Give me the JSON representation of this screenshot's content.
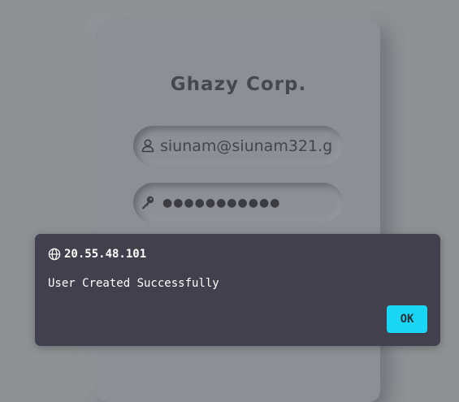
{
  "card": {
    "title": "Ghazy Corp."
  },
  "form": {
    "email_value": "siunam@siunam321.g",
    "password_value": "●●●●●●●●●●●",
    "user_icon": "user-icon",
    "password_icon": "key-icon"
  },
  "dialog": {
    "origin": "20.55.48.101",
    "origin_icon": "globe-icon",
    "message": "User Created Successfully",
    "ok_label": "OK"
  },
  "colors": {
    "page_background": "#8f9094",
    "dialog_background": "#43404d",
    "ok_button": "#18d6f4",
    "title_text": "#48484c"
  }
}
